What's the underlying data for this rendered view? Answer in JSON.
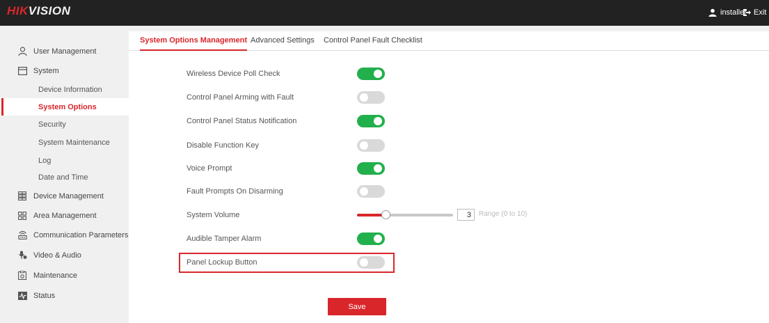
{
  "header": {
    "logo_hik": "HIK",
    "logo_vision": "VISION",
    "user_name": "installer",
    "exit_label": "Exit",
    "icons": {
      "user": "user-icon",
      "exit": "exit-icon"
    }
  },
  "sidebar": {
    "items": [
      {
        "label": "User Management",
        "icon": "user-outline-icon"
      },
      {
        "label": "System",
        "icon": "system-window-icon"
      },
      {
        "label": "Device Management",
        "icon": "device-grid-icon"
      },
      {
        "label": "Area Management",
        "icon": "area-grid-icon"
      },
      {
        "label": "Communication Parameters",
        "icon": "network-icon"
      },
      {
        "label": "Video & Audio",
        "icon": "video-audio-icon"
      },
      {
        "label": "Maintenance",
        "icon": "maintenance-icon"
      },
      {
        "label": "Status",
        "icon": "status-monitor-icon"
      }
    ],
    "system_sub": [
      "Device Information",
      "System Options",
      "Security",
      "System Maintenance",
      "Log",
      "Date and Time"
    ],
    "active_sub": "System Options"
  },
  "tabs": [
    {
      "label": "System Options Management",
      "active": true
    },
    {
      "label": "Advanced Settings",
      "active": false
    },
    {
      "label": "Control Panel Fault Checklist",
      "active": false
    }
  ],
  "options": [
    {
      "label": "Wireless Device Poll Check",
      "enabled": true
    },
    {
      "label": "Control Panel Arming with Fault",
      "enabled": false
    },
    {
      "label": "Control Panel Status Notification",
      "enabled": true
    },
    {
      "label": "Disable Function Key",
      "enabled": false
    },
    {
      "label": "Voice Prompt",
      "enabled": true
    },
    {
      "label": "Fault Prompts On Disarming",
      "enabled": false
    },
    {
      "label": "Audible Tamper Alarm",
      "enabled": true
    },
    {
      "label": "Panel Lockup Button",
      "enabled": false
    }
  ],
  "volume": {
    "label": "System Volume",
    "value": "3",
    "min": 0,
    "max": 10,
    "range_hint": "Range (0 to 10)"
  },
  "save_label": "Save",
  "colors": {
    "accent": "#d9262b",
    "toggle_on": "#21b04b",
    "toggle_off": "#d9d9d9",
    "topbar": "#222222"
  }
}
